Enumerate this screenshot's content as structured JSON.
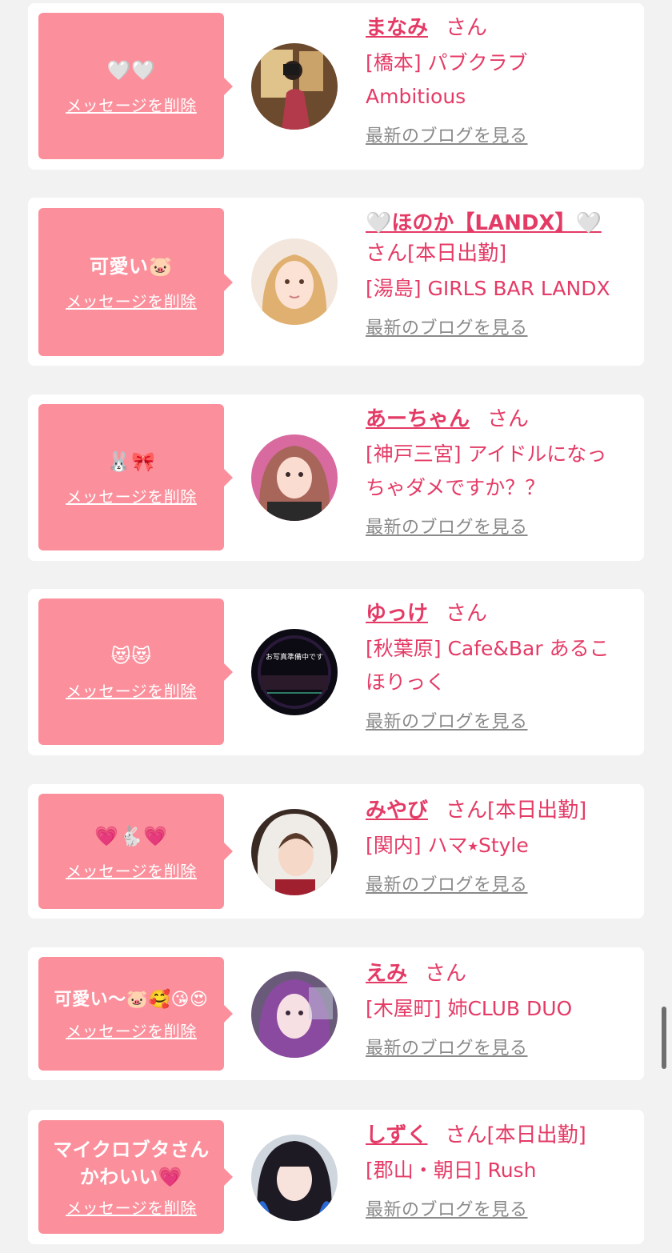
{
  "delete_label": "メッセージを削除",
  "blog_label": "最新のブログを見る",
  "colors": {
    "accent": "#e43b66",
    "bubble": "#fb909c",
    "link_gray": "#8a8a8a",
    "bg": "#f2f2f2"
  },
  "entries": [
    {
      "message": "🤍🤍",
      "name": "まなみ",
      "suffix": "さん",
      "shop_lines": [
        "[橋本] パブクラブ",
        "Ambitious"
      ]
    },
    {
      "message": "可愛い🐷",
      "name": "🤍ほのか【LANDX】🤍",
      "suffix": "さん[本日出勤]",
      "shop_lines": [
        "[湯島] GIRLS BAR LANDX"
      ]
    },
    {
      "message": "🐰🎀",
      "name": "あーちゃん",
      "suffix": "さん",
      "shop_lines": [
        "[神戸三宮] アイドルになっ",
        "ちゃダメですか？？"
      ]
    },
    {
      "message": "😻😻",
      "name": "ゆっけ",
      "suffix": "さん",
      "shop_lines": [
        "[秋葉原] Cafe&Bar あるこ",
        "ほりっく"
      ]
    },
    {
      "message": "💗🐇💗",
      "name": "みやび",
      "suffix": "さん[本日出勤]",
      "shop_lines": [
        "[関内] ハマ⭑Style"
      ]
    },
    {
      "message": "可愛い〜🐷🥰😘😍",
      "name": "えみ",
      "suffix": "さん",
      "shop_lines": [
        "[木屋町] 姉CLUB DUO"
      ]
    },
    {
      "message": "マイクロブタさんかわいい💗",
      "name": "しずく",
      "suffix": "さん[本日出勤]",
      "shop_lines": [
        "[郡山・朝日] Rush"
      ]
    }
  ],
  "avatar_overlay_text": "お写真準備中です"
}
